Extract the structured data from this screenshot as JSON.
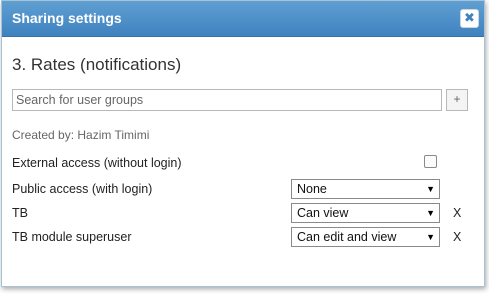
{
  "dialog": {
    "title": "Sharing settings",
    "close_glyph": "✖",
    "heading": "3. Rates (notifications)"
  },
  "search": {
    "placeholder": "Search for user groups",
    "add_label": "+"
  },
  "created_by": "Created by: Hazim Timimi",
  "external_access": {
    "label": "External access (without login)",
    "checked": false
  },
  "public_access": {
    "label": "Public access (with login)",
    "value": "None"
  },
  "groups": [
    {
      "label": "TB",
      "value": "Can view",
      "remove": "X"
    },
    {
      "label": "TB module superuser",
      "value": "Can edit and view",
      "remove": "X"
    }
  ],
  "icons": {
    "close": "close-icon",
    "add": "plus-icon",
    "dropdown": "dropdown-arrow-icon"
  }
}
